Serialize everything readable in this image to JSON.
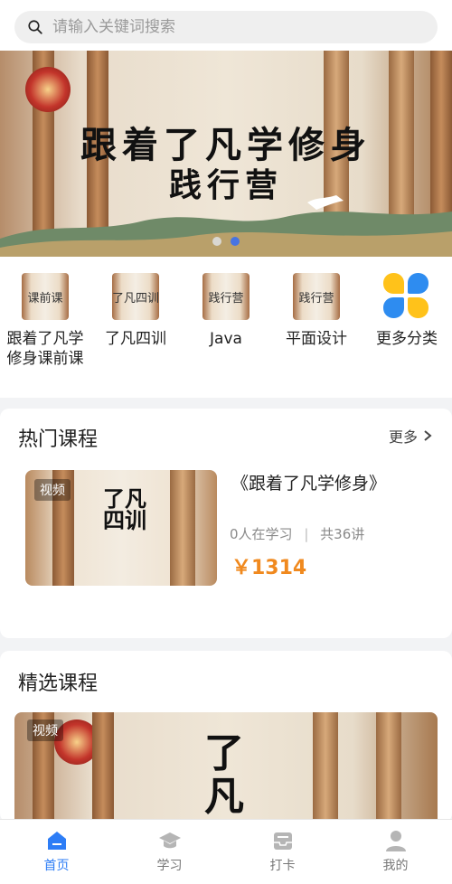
{
  "search": {
    "placeholder": "请输入关键词搜索",
    "value": ""
  },
  "banner": {
    "title_line1": "跟着了凡学修身",
    "title_line2": "践行营",
    "active_dot": 1,
    "dot_count": 2
  },
  "categories": [
    {
      "label": "跟着了凡学修身课前课",
      "thumb_text": "课前课"
    },
    {
      "label": "了凡四训",
      "thumb_text": "了凡四训"
    },
    {
      "label": "Java",
      "thumb_text": "践行营"
    },
    {
      "label": "平面设计",
      "thumb_text": "践行营"
    },
    {
      "label": "更多分类",
      "icon": "clover-icon"
    }
  ],
  "hot_courses": {
    "title": "热门课程",
    "more_label": "更多",
    "course": {
      "tag": "视频",
      "thumb_text": "了凡四训",
      "title": "《跟着了凡学修身》",
      "learners": "0人在学习",
      "lessons": "共36讲",
      "price": "￥1314"
    }
  },
  "featured": {
    "title": "精选课程",
    "tag": "视频",
    "thumb_text": "了凡"
  },
  "tabbar": [
    {
      "label": "首页",
      "icon": "home-icon",
      "active": true
    },
    {
      "label": "学习",
      "icon": "mortarboard-icon",
      "active": false
    },
    {
      "label": "打卡",
      "icon": "inbox-icon",
      "active": false
    },
    {
      "label": "我的",
      "icon": "user-icon",
      "active": false
    }
  ],
  "colors": {
    "accent": "#2d7df6",
    "price": "#f0891e",
    "banner_dot_active": "#3b6ff0"
  }
}
